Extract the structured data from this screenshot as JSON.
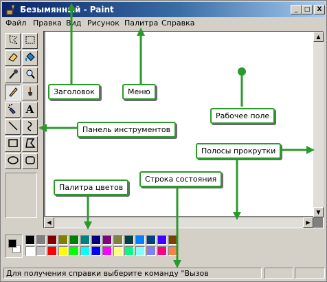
{
  "window": {
    "title": "Безымянный - Paint"
  },
  "title_buttons": {
    "minimize": "_",
    "maximize": "□",
    "close": "X"
  },
  "menu": [
    "Файл",
    "Правка",
    "Вид",
    "Рисунок",
    "Палитра",
    "Справка"
  ],
  "tools": [
    "free-select",
    "rect-select",
    "eraser",
    "fill",
    "color-picker",
    "magnifier",
    "pencil",
    "brush",
    "airbrush",
    "text",
    "line",
    "curve",
    "rectangle",
    "polygon",
    "ellipse",
    "rounded-rectangle"
  ],
  "text_tool_glyph": "A",
  "selected_tool": "pencil",
  "palette": {
    "foreground": "#000000",
    "background": "#ffffff",
    "colors_row1": [
      "#000000",
      "#808080",
      "#800000",
      "#808000",
      "#008000",
      "#008080",
      "#000080",
      "#800080",
      "#808040",
      "#004040",
      "#0080ff",
      "#004080",
      "#4000ff",
      "#804000"
    ],
    "colors_row2": [
      "#ffffff",
      "#c0c0c0",
      "#ff0000",
      "#ffff00",
      "#00ff00",
      "#00ffff",
      "#0000ff",
      "#ff00ff",
      "#ffff80",
      "#00ff80",
      "#80ffff",
      "#8080ff",
      "#ff0080",
      "#ff8040"
    ]
  },
  "status": {
    "text": "Для получения справки выберите команду \"Вызов"
  },
  "annotations": {
    "title": "Заголовок",
    "menu": "Меню",
    "workspace": "Рабочее поле",
    "toolbox": "Панель инструментов",
    "scrollbars": "Полосы прокрутки",
    "palette": "Палитра цветов",
    "statusbar": "Строка состояния"
  },
  "accent_color": "#2a9a2a"
}
